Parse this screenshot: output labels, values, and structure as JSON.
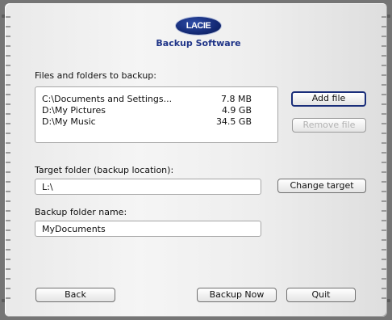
{
  "header": {
    "brand": "LACIE",
    "title": "Backup Software"
  },
  "files": {
    "label": "Files and folders to backup:",
    "items": [
      {
        "name": "C:\\Documents and Settings...",
        "size": "7.8 MB"
      },
      {
        "name": "D:\\My Pictures",
        "size": "4.9 GB"
      },
      {
        "name": "D:\\My Music",
        "size": "34.5 GB"
      }
    ],
    "add_label": "Add file",
    "remove_label": "Remove file"
  },
  "target": {
    "label": "Target folder (backup location):",
    "value": "L:\\",
    "change_label": "Change target"
  },
  "backup_name": {
    "label": "Backup folder name:",
    "value": "MyDocuments"
  },
  "footer": {
    "back_label": "Back",
    "backup_now_label": "Backup Now",
    "quit_label": "Quit"
  }
}
